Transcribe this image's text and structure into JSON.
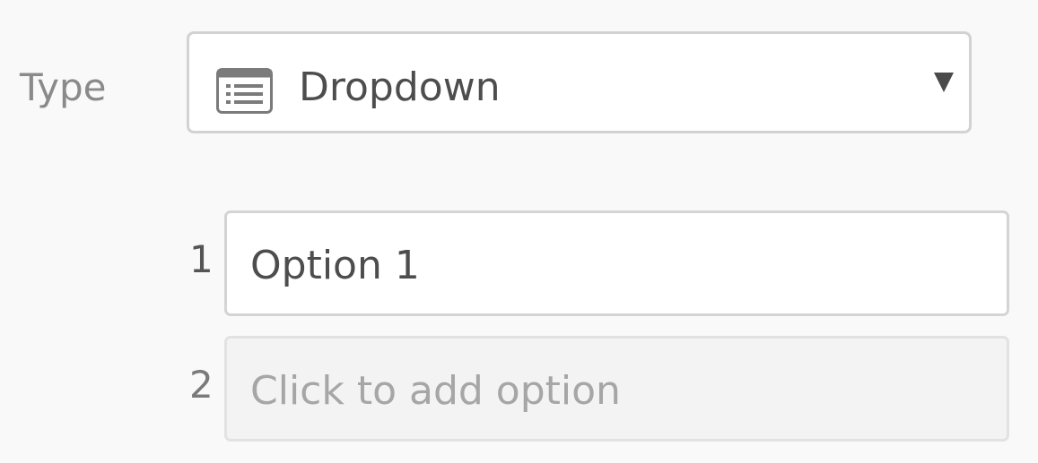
{
  "field": {
    "label": "Type",
    "selected_type": "Dropdown",
    "type_icon": "list-icon"
  },
  "options": [
    {
      "number": "1",
      "value": "Option 1"
    },
    {
      "number": "2",
      "placeholder": "Click to add option"
    }
  ],
  "colors": {
    "label": "#8a8a8a",
    "border": "#d2d2d2",
    "placeholder": "#a6a6a6",
    "background": "#f9f9f9"
  }
}
